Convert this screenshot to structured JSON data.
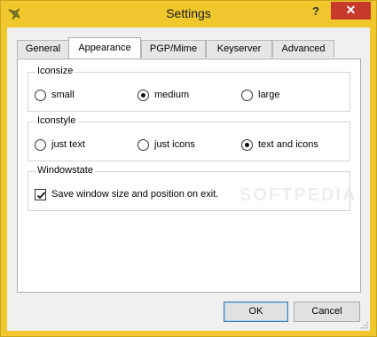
{
  "window": {
    "title": "Settings",
    "help_label": "?",
    "close_label": "✕"
  },
  "tabs": [
    {
      "label": "General"
    },
    {
      "label": "Appearance"
    },
    {
      "label": "PGP/Mime"
    },
    {
      "label": "Keyserver"
    },
    {
      "label": "Advanced"
    }
  ],
  "active_tab": "Appearance",
  "iconsize": {
    "label": "Iconsize",
    "options": [
      {
        "label": "small",
        "checked": false
      },
      {
        "label": "medium",
        "checked": true
      },
      {
        "label": "large",
        "checked": false
      }
    ]
  },
  "iconstyle": {
    "label": "Iconstyle",
    "options": [
      {
        "label": "just text",
        "checked": false
      },
      {
        "label": "just icons",
        "checked": false
      },
      {
        "label": "text and icons",
        "checked": true
      }
    ]
  },
  "windowstate": {
    "label": "Windowstate",
    "save_option": {
      "label": "Save window size and position on exit.",
      "checked": true
    }
  },
  "watermark": "SOFTPEDIA",
  "buttons": {
    "ok": "OK",
    "cancel": "Cancel"
  },
  "colors": {
    "titlebar": "#f0c82e",
    "close": "#c7392b",
    "default_button_border": "#3c7fb1"
  }
}
